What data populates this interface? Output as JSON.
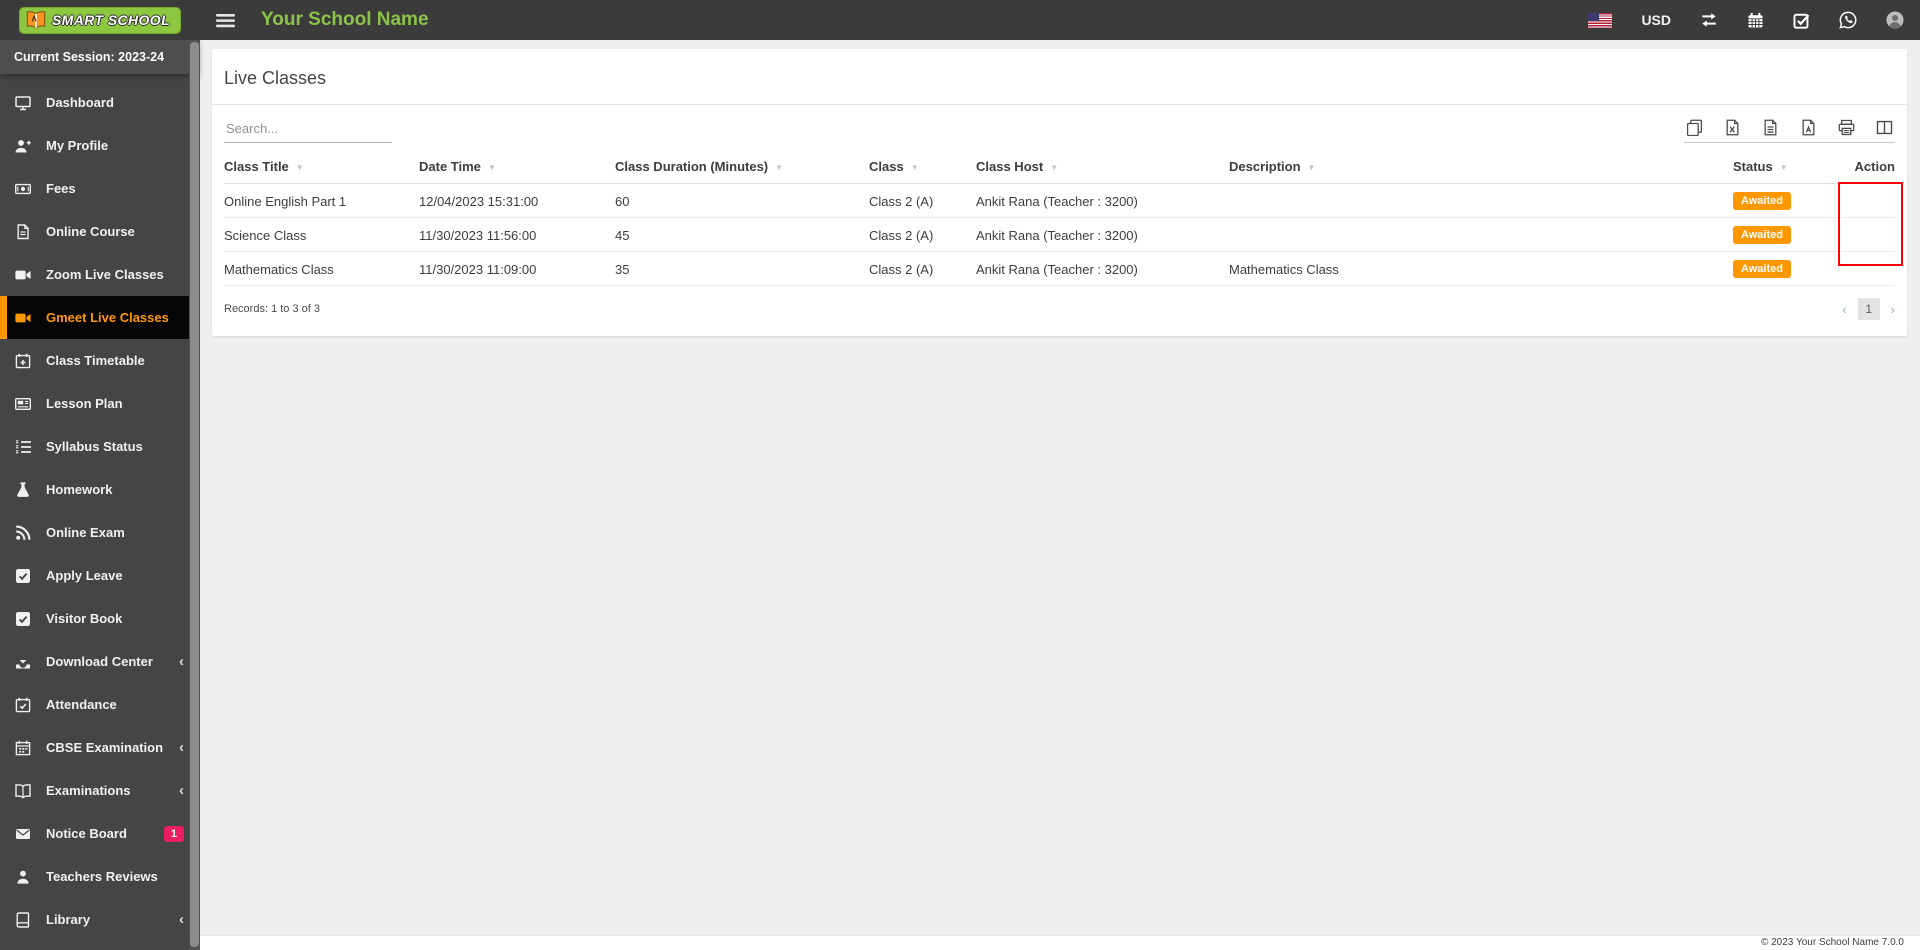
{
  "brand": {
    "logo_text": "SMART SCHOOL",
    "school_name": "Your School Name"
  },
  "header": {
    "currency": "USD"
  },
  "sidebar": {
    "session_label": "Current Session: 2023-24",
    "items": [
      {
        "label": "Dashboard",
        "icon": "monitor"
      },
      {
        "label": "My Profile",
        "icon": "user-plus"
      },
      {
        "label": "Fees",
        "icon": "money"
      },
      {
        "label": "Online Course",
        "icon": "file"
      },
      {
        "label": "Zoom Live Classes",
        "icon": "videocam"
      },
      {
        "label": "Gmeet Live Classes",
        "icon": "videocam",
        "active": true
      },
      {
        "label": "Class Timetable",
        "icon": "calendar-plus"
      },
      {
        "label": "Lesson Plan",
        "icon": "card"
      },
      {
        "label": "Syllabus Status",
        "icon": "list-ol"
      },
      {
        "label": "Homework",
        "icon": "flask"
      },
      {
        "label": "Online Exam",
        "icon": "rss"
      },
      {
        "label": "Apply Leave",
        "icon": "check-square"
      },
      {
        "label": "Visitor Book",
        "icon": "check-square"
      },
      {
        "label": "Download Center",
        "icon": "download",
        "chevron": true
      },
      {
        "label": "Attendance",
        "icon": "calendar-check"
      },
      {
        "label": "CBSE Examination",
        "icon": "calendar-grid",
        "chevron": true
      },
      {
        "label": "Examinations",
        "icon": "book-open",
        "chevron": true
      },
      {
        "label": "Notice Board",
        "icon": "envelope",
        "badge": "1"
      },
      {
        "label": "Teachers Reviews",
        "icon": "user"
      },
      {
        "label": "Library",
        "icon": "book",
        "chevron": true
      }
    ]
  },
  "main": {
    "page_title": "Live Classes",
    "search_placeholder": "Search...",
    "table": {
      "columns": [
        "Class Title",
        "Date Time",
        "Class Duration (Minutes)",
        "Class",
        "Class Host",
        "Description",
        "Status",
        "Action"
      ],
      "rows": [
        {
          "class_title": "Online English Part 1",
          "date_time": "12/04/2023 15:31:00",
          "duration": "60",
          "class_name": "Class 2 (A)",
          "class_host": "Ankit Rana (Teacher : 3200)",
          "description": "",
          "status": "Awaited"
        },
        {
          "class_title": "Science Class",
          "date_time": "11/30/2023 11:56:00",
          "duration": "45",
          "class_name": "Class 2 (A)",
          "class_host": "Ankit Rana (Teacher : 3200)",
          "description": "",
          "status": "Awaited"
        },
        {
          "class_title": "Mathematics Class",
          "date_time": "11/30/2023 11:09:00",
          "duration": "35",
          "class_name": "Class 2 (A)",
          "class_host": "Ankit Rana (Teacher : 3200)",
          "description": "Mathematics Class",
          "status": "Awaited"
        }
      ],
      "records_text": "Records: 1 to 3 of 3",
      "pagination": {
        "prev": "‹",
        "page": "1",
        "next": "›"
      }
    }
  },
  "footer": {
    "copyright": "© 2023 Your School Name 7.0.0"
  },
  "colors": {
    "accent_orange": "#ff9800",
    "brand_green": "#8bc34a",
    "badge_pink": "#e91e63",
    "annotation_red": "#ff0000"
  }
}
